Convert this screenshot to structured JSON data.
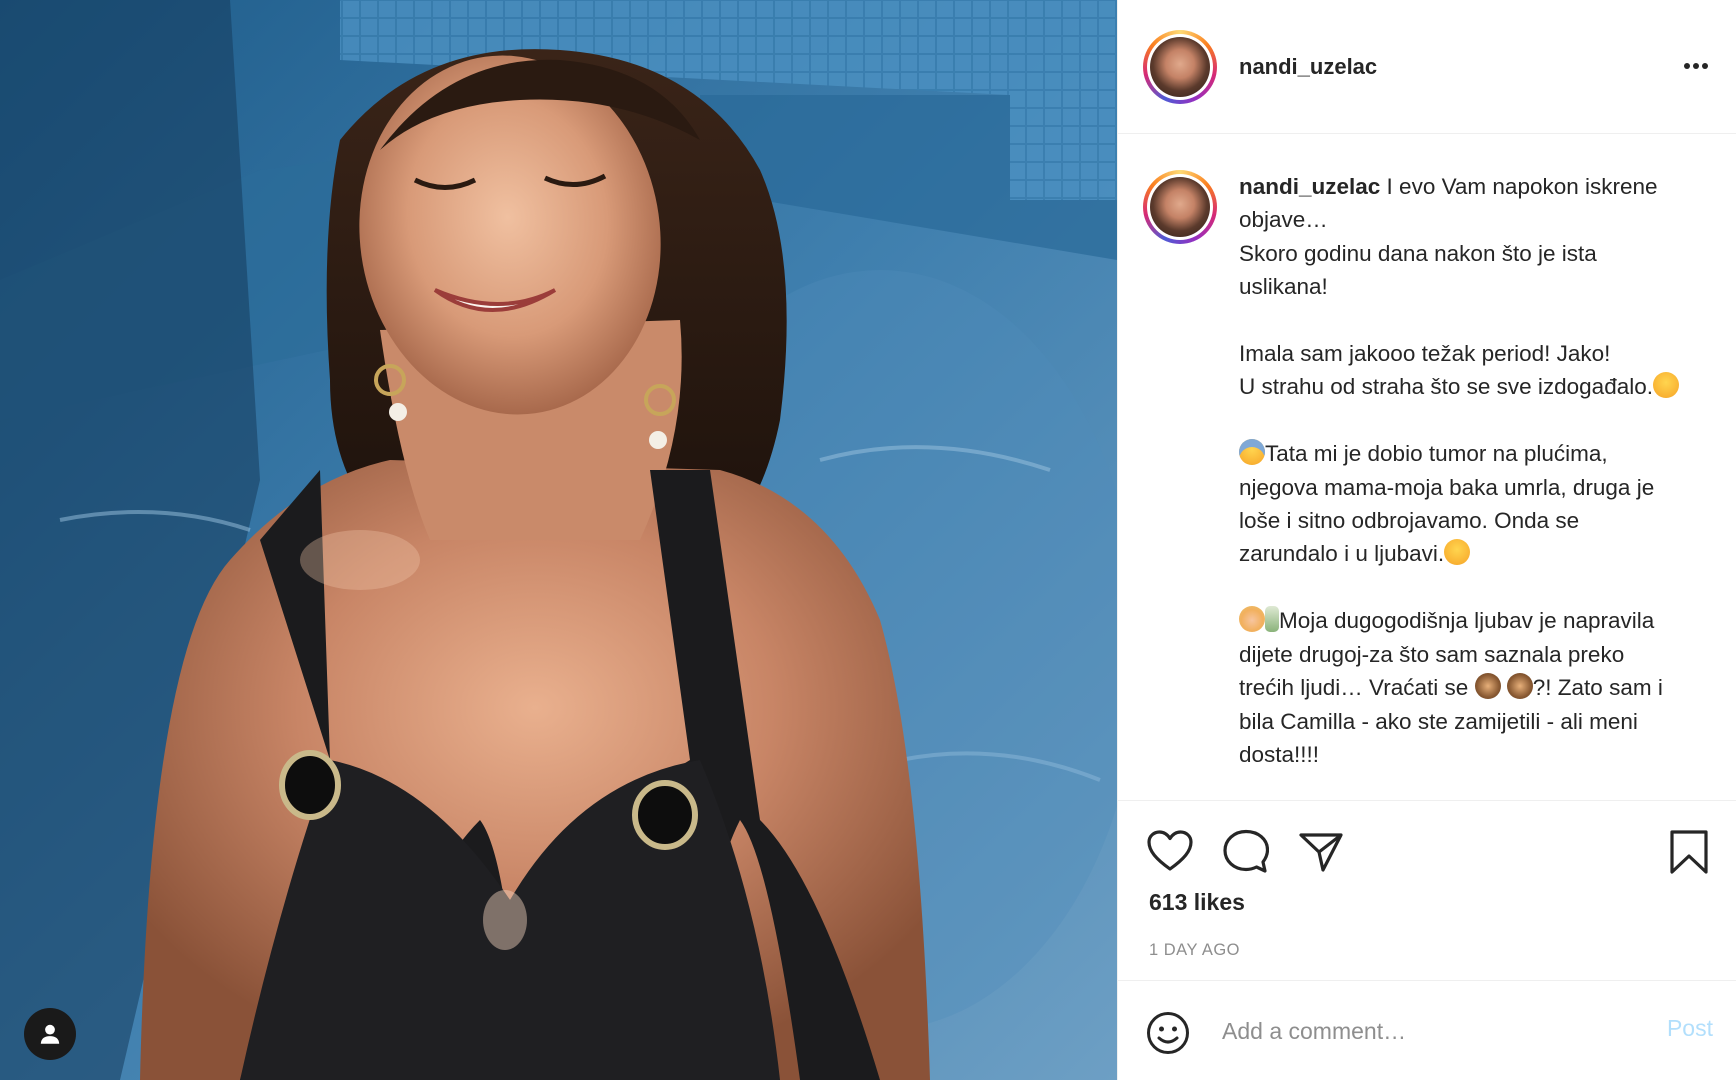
{
  "post": {
    "username": "nandi_uzelac",
    "caption": {
      "username": "nandi_uzelac",
      "p1": " I evo Vam napokon iskrene objave…\nSkoro godinu dana nakon što je ista uslikana!",
      "p2": "Imala sam jakooo težak period! Jako!\nU strahu od straha što se sve izdogađalo.",
      "p3": "Tata mi je dobio tumor na plućima, njegova mama-moja baka umrla, druga je loše i sitno odbrojavamo. Onda se zarundalo i u ljubavi.",
      "p4": "Moja dugogodišnja ljubav je napravila dijete drugoj-za što sam saznala preko trećih ljudi… Vraćati se ",
      "p4b": "?! Zato sam i bila Camilla - ako ste zamijetili - ali meni dosta!!!!"
    },
    "likes": "613 likes",
    "time": "1 DAY AGO",
    "comment": {
      "placeholder": "Add a comment…",
      "post_label": "Post"
    }
  },
  "icons": {
    "more": "more-options-icon",
    "like": "heart-icon",
    "comment": "comment-icon",
    "share": "share-icon",
    "save": "bookmark-icon",
    "emoji": "emoji-icon",
    "tag": "tagged-user-icon"
  },
  "colors": {
    "accent_disabled": "#b2dffc",
    "secondary_text": "#8e8e8e",
    "border": "#efefef"
  }
}
